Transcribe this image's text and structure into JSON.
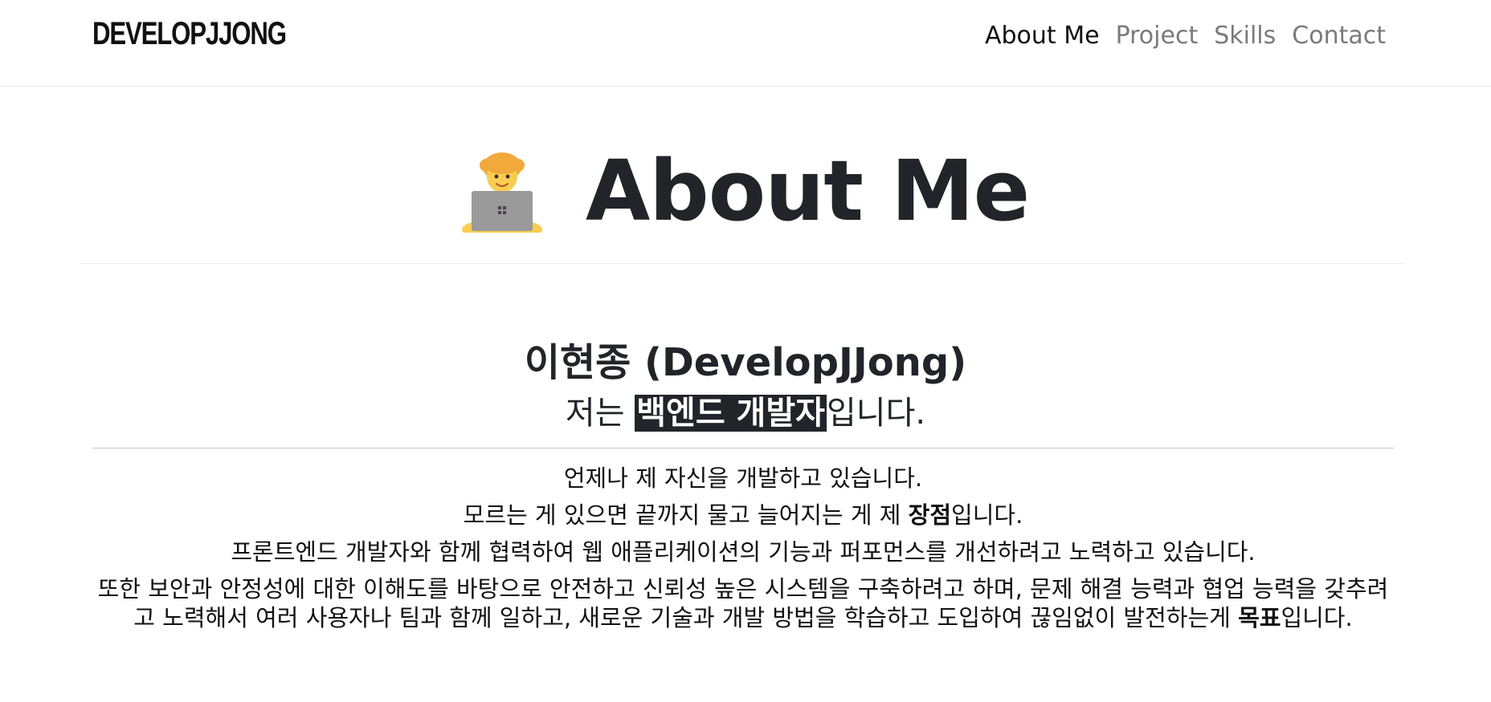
{
  "header": {
    "brand": "DEVELOPJJONG",
    "nav": [
      {
        "label": "About Me",
        "active": true
      },
      {
        "label": "Project",
        "active": false
      },
      {
        "label": "Skills",
        "active": false
      },
      {
        "label": "Contact",
        "active": false
      }
    ]
  },
  "about": {
    "icon": "technologist-emoji-icon",
    "title": "About Me",
    "name": "이현종 (DevelopJJong)",
    "role_prefix": "저는 ",
    "role_highlight": "백엔드 개발자",
    "role_suffix": "입니다.",
    "paragraphs": [
      {
        "before": "언제나 제 자신을 개발하고 있습니다.",
        "bold": "",
        "after": ""
      },
      {
        "before": "모르는 게 있으면 끝까지 물고 늘어지는 게 제 ",
        "bold": "장점",
        "after": "입니다."
      },
      {
        "before": "프론트엔드 개발자와 함께 협력하여 웹 애플리케이션의 기능과 퍼포먼스를 개선하려고 노력하고 있습니다.",
        "bold": "",
        "after": ""
      },
      {
        "before": "또한 보안과 안정성에 대한 이해도를 바탕으로 안전하고 신뢰성 높은 시스템을 구축하려고 하며, 문제 해결 능력과 협업 능력을 갖추려고 노력해서 여러 사용자나 팀과 함께 일하고, 새로운 기술과 개발 방법을 학습하고 도입하여 끊임없이 발전하는게 ",
        "bold": "목표",
        "after": "입니다."
      }
    ]
  },
  "colors": {
    "text": "#212529",
    "nav_inactive": "#7a7a7a",
    "highlight_bg": "#212529",
    "highlight_text": "#ffffff"
  }
}
